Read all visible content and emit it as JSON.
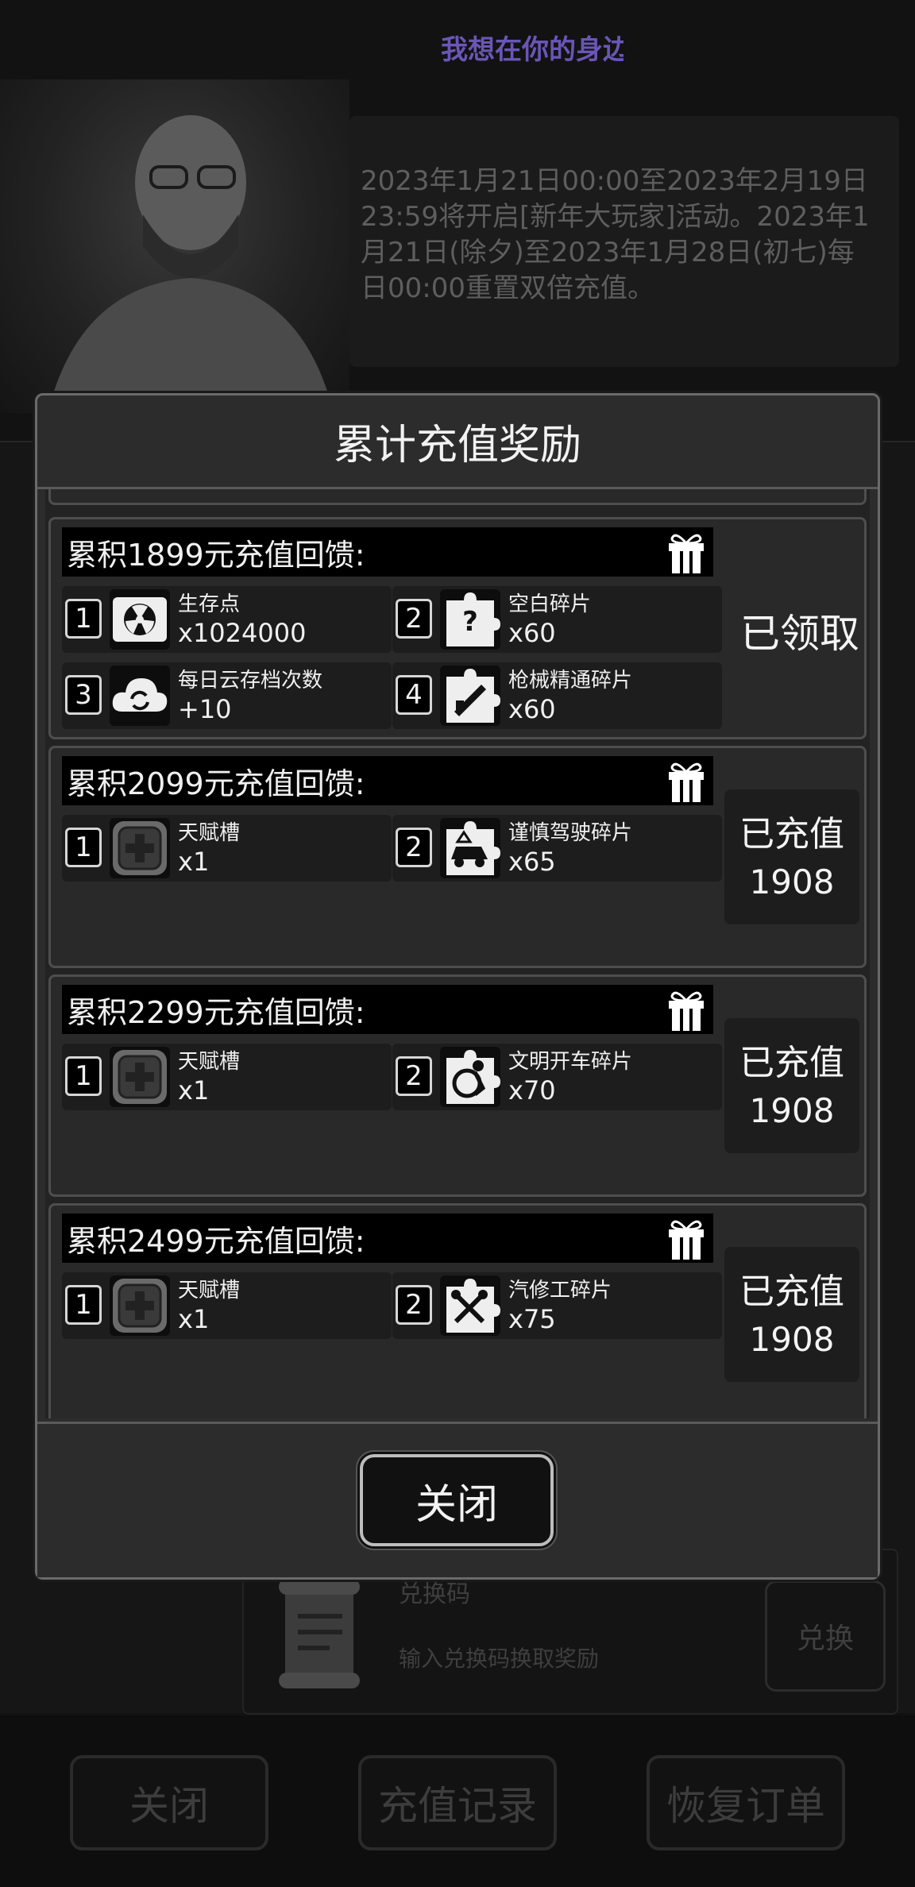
{
  "marquee": "我想在你的身边",
  "notice": "2023年1月21日00:00至2023年2月19日23:59将开启[新年大玩家]活动。2023年1月21日(除夕)至2023年1月28日(初七)每日00:00重置双倍充值。",
  "redeem": {
    "label": "兑换码",
    "placeholder": "输入兑换码换取奖励",
    "button": "兑换"
  },
  "bottom_bar": {
    "close": "关闭",
    "history": "充值记录",
    "restore": "恢复订单"
  },
  "modal": {
    "title": "累计充值奖励",
    "close_label": "关闭",
    "tiers": [
      {
        "title": "累积1899元充值回馈:",
        "status": "已领取",
        "rewards": [
          {
            "num": "1",
            "name": "生存点",
            "count": "x1024000",
            "icon": "radiation-chest-icon"
          },
          {
            "num": "2",
            "name": "空白碎片",
            "count": "x60",
            "icon": "question-puzzle-icon"
          },
          {
            "num": "3",
            "name": "每日云存档次数",
            "count": "+10",
            "icon": "cloud-sync-icon"
          },
          {
            "num": "4",
            "name": "枪械精通碎片",
            "count": "x60",
            "icon": "gun-puzzle-icon"
          }
        ]
      },
      {
        "title": "累积2099元充值回馈:",
        "status_label": "已充值",
        "status_value": "1908",
        "rewards": [
          {
            "num": "1",
            "name": "天赋槽",
            "count": "x1",
            "icon": "talent-slot-icon"
          },
          {
            "num": "2",
            "name": "谨慎驾驶碎片",
            "count": "x65",
            "icon": "car-puzzle-icon"
          }
        ]
      },
      {
        "title": "累积2299元充值回馈:",
        "status_label": "已充值",
        "status_value": "1908",
        "rewards": [
          {
            "num": "1",
            "name": "天赋槽",
            "count": "x1",
            "icon": "talent-slot-icon"
          },
          {
            "num": "2",
            "name": "文明开车碎片",
            "count": "x70",
            "icon": "driver-puzzle-icon"
          }
        ]
      },
      {
        "title": "累积2499元充值回馈:",
        "status_label": "已充值",
        "status_value": "1908",
        "rewards": [
          {
            "num": "1",
            "name": "天赋槽",
            "count": "x1",
            "icon": "talent-slot-icon"
          },
          {
            "num": "2",
            "name": "汽修工碎片",
            "count": "x75",
            "icon": "mechanic-puzzle-icon"
          }
        ]
      }
    ]
  }
}
